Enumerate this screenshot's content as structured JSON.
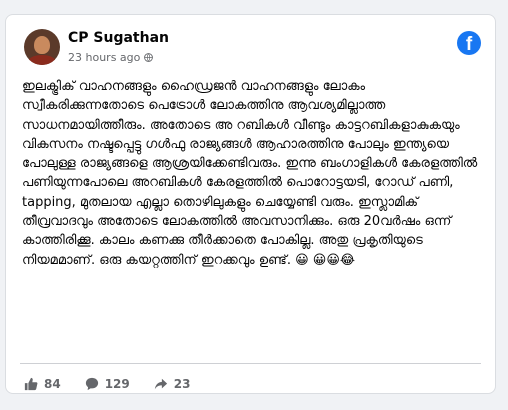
{
  "post": {
    "author": "CP Sugathan",
    "timestamp": "23 hours ago",
    "body": "ഇലക്ട്രിക് വാഹനങ്ങളും ഹൈഡ്രജൻ വാഹനങ്ങളും ലോകം സ്വീകരിക്കുന്നതോടെ പെട്രോൾ ലോകത്തിനു ആവശ്യമില്ലാത്ത സാധനമായിത്തീരും. അതോടെ അ റബികൾ വീണ്ടും കാട്ടറബികളാകുകയും വികസനം നഷ്ടപ്പെട്ടു ഗൾഫു രാജ്യങ്ങൾ ആഹാരത്തിനു പോലും ഇന്ത്യയെ പോലുള്ള രാജ്യങ്ങളെ ആശ്രയിക്കേണ്ടിവരും. ഇന്നു ബംഗാളികൾ കേരളത്തിൽ പണിയുന്നപോലെ അറബികൾ കേരളത്തിൽ പൊറോട്ടയടി, റോഡ് പണി, tapping, മുതലായ എല്ലാ തൊഴിലുകളും ചെയ്യേണ്ടി വരും. ഇസ്ലാമിക് തീവ്രവാദവും അതോടെ ലോകത്തിൽ അവസാനിക്കും. ഒരു 20വർഷം ഒന്ന് കാത്തിരിക്കൂ. കാലം കണക്കു തീർക്കാതെ പോകില്ല. അതു പ്രകൃതിയുടെ നിയമമാണ്. ഒരു കയറ്റത്തിന് ഇറക്കവും ഉണ്ട്. 😀 😀😀😂"
  },
  "stats": {
    "likes": "84",
    "comments": "129",
    "shares": "23"
  },
  "colors": {
    "brand": "#1877f2",
    "muted": "#65676b",
    "text": "#050505"
  },
  "icons": {
    "platform": "facebook-logo-icon",
    "privacy": "globe-icon",
    "likes": "thumbs-up-icon",
    "comments": "comment-icon",
    "shares": "share-arrow-icon"
  }
}
